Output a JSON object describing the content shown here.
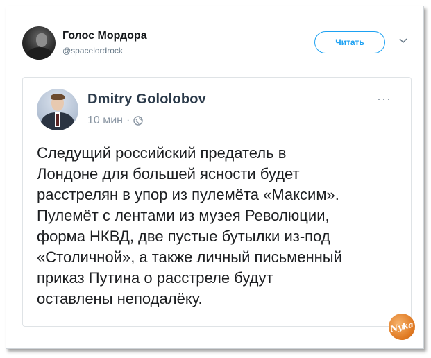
{
  "tweet": {
    "author_name": "Голос Мордора",
    "author_handle": "@spacelordrock",
    "follow_label": "Читать"
  },
  "embedded_post": {
    "author_name": "Dmitry Gololobov",
    "time": "10 мин",
    "separator": "·",
    "more": "···",
    "text_lines": [
      "Следущий российский предатель в",
      "Лондоне для большей ясности будет",
      "расстрелян в упор из пулемёта «Максим».",
      "Пулемёт с лентами из музея Революции,",
      "форма НКВД, две пустые бутылки из-под",
      "«Столичной», а также личный письменный",
      "приказ Путина о расстреле будут",
      "оставлены неподалёку."
    ]
  },
  "watermark": {
    "text": "Nyka"
  },
  "colors": {
    "accent": "#1da1f2",
    "muted": "#657786",
    "text": "#14171a",
    "watermark": "#e07a23"
  },
  "icons": [
    "chevron-down-icon",
    "globe-icon",
    "more-icon"
  ]
}
